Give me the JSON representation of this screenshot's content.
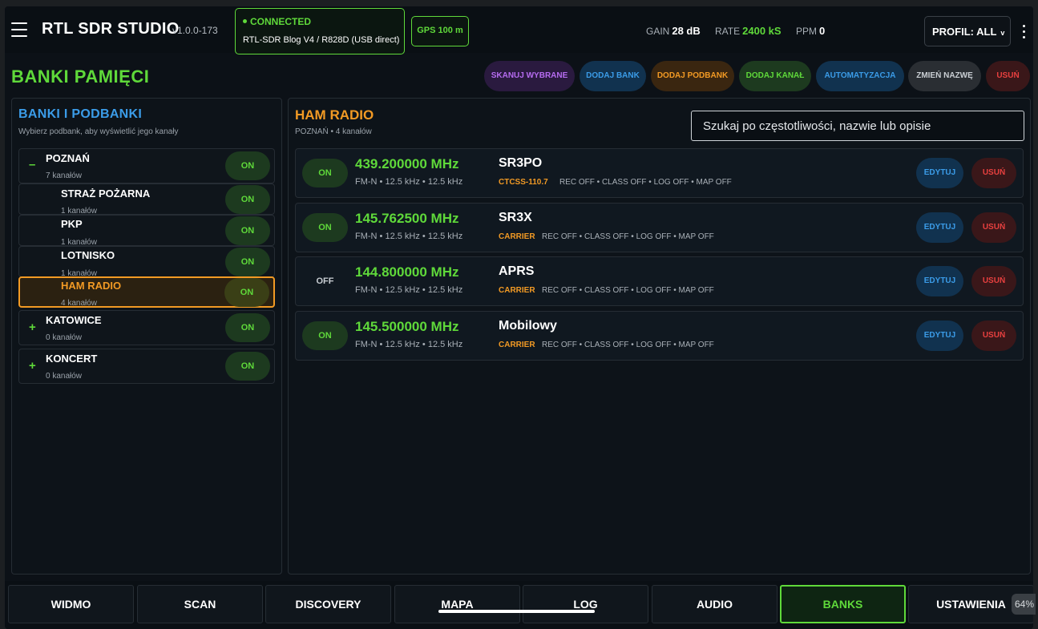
{
  "header": {
    "title": "RTL SDR STUDIO",
    "version": "v1.0.0-173",
    "connection": {
      "status": "CONNECTED",
      "device": "RTL-SDR Blog V4 / R828D (USB direct)"
    },
    "gps": "GPS 100 m",
    "gain": {
      "label": "GAIN",
      "value": "28 dB"
    },
    "rate": {
      "label": "RATE",
      "value": "2400 kS"
    },
    "ppm": {
      "label": "PPM",
      "value": "0"
    },
    "profile": "PROFIL: ALL",
    "profile_chevron": "v",
    "icons": {
      "menu": "hamburger-icon",
      "more": "kebab-icon"
    }
  },
  "page": {
    "title": "BANKI PAMIĘCI"
  },
  "toolbar": {
    "scan_selected": "SKANUJ WYBRANE",
    "add_bank": "DODAJ BANK",
    "add_subbank": "DODAJ PODBANK",
    "add_channel": "DODAJ KANAŁ",
    "automation": "AUTOMATYZACJA",
    "rename": "ZMIEŃ NAZWĘ",
    "delete": "USUŃ"
  },
  "banks_panel": {
    "title": "BANKI I PODBANKI",
    "subtitle": "Wybierz podbank, aby wyświetlić jego kanały",
    "items": [
      {
        "expander": "–",
        "name": "POZNAŃ",
        "count": "7 kanałów",
        "state": "ON"
      },
      {
        "name": "STRAŻ POŻARNA",
        "count": "1 kanałów",
        "state": "ON"
      },
      {
        "name": "PKP",
        "count": "1 kanałów",
        "state": "ON"
      },
      {
        "name": "LOTNISKO",
        "count": "1 kanałów",
        "state": "ON"
      },
      {
        "name": "HAM RADIO",
        "count": "4 kanałów",
        "state": "ON",
        "selected": true
      },
      {
        "expander": "+",
        "name": "KATOWICE",
        "count": "0 kanałów",
        "state": "ON"
      },
      {
        "expander": "+",
        "name": "KONCERT",
        "count": "0 kanałów",
        "state": "ON"
      }
    ]
  },
  "channels_panel": {
    "title": "HAM RADIO",
    "subtitle": "POZNAŃ • 4 kanałów",
    "search_placeholder": "Szukaj po częstotliwości, nazwie lub opisie",
    "edit_label": "EDYTUJ",
    "delete_label": "USUŃ",
    "channels": [
      {
        "state": "ON",
        "freq": "439.200000 MHz",
        "mode": "FM-N • 12.5 kHz • 12.5 kHz",
        "name": "SR3PO",
        "tone": "CTCSS-110.7",
        "flags": "REC OFF • CLASS OFF • LOG OFF • MAP OFF"
      },
      {
        "state": "ON",
        "freq": "145.762500 MHz",
        "mode": "FM-N • 12.5 kHz • 12.5 kHz",
        "name": "SR3X",
        "tone": "CARRIER",
        "flags": "REC OFF • CLASS OFF • LOG OFF • MAP OFF"
      },
      {
        "state": "OFF",
        "freq": "144.800000 MHz",
        "mode": "FM-N • 12.5 kHz • 12.5 kHz",
        "name": "APRS",
        "tone": "CARRIER",
        "flags": "REC OFF • CLASS OFF • LOG OFF • MAP OFF"
      },
      {
        "state": "ON",
        "freq": "145.500000 MHz",
        "mode": "FM-N • 12.5 kHz • 12.5 kHz",
        "name": "Mobilowy",
        "tone": "CARRIER",
        "flags": "REC OFF • CLASS OFF • LOG OFF • MAP OFF"
      }
    ]
  },
  "bottom_nav": {
    "tabs": [
      "WIDMO",
      "SCAN",
      "DISCOVERY",
      "MAPA",
      "LOG",
      "AUDIO",
      "BANKS",
      "USTAWIENIA"
    ],
    "active": "BANKS",
    "zoom": "64%"
  },
  "colors": {
    "accent_green": "#5fd93a",
    "accent_orange": "#f29a24",
    "accent_blue": "#3b9ce8",
    "danger_red": "#e8403f",
    "background": "#0c1117"
  }
}
